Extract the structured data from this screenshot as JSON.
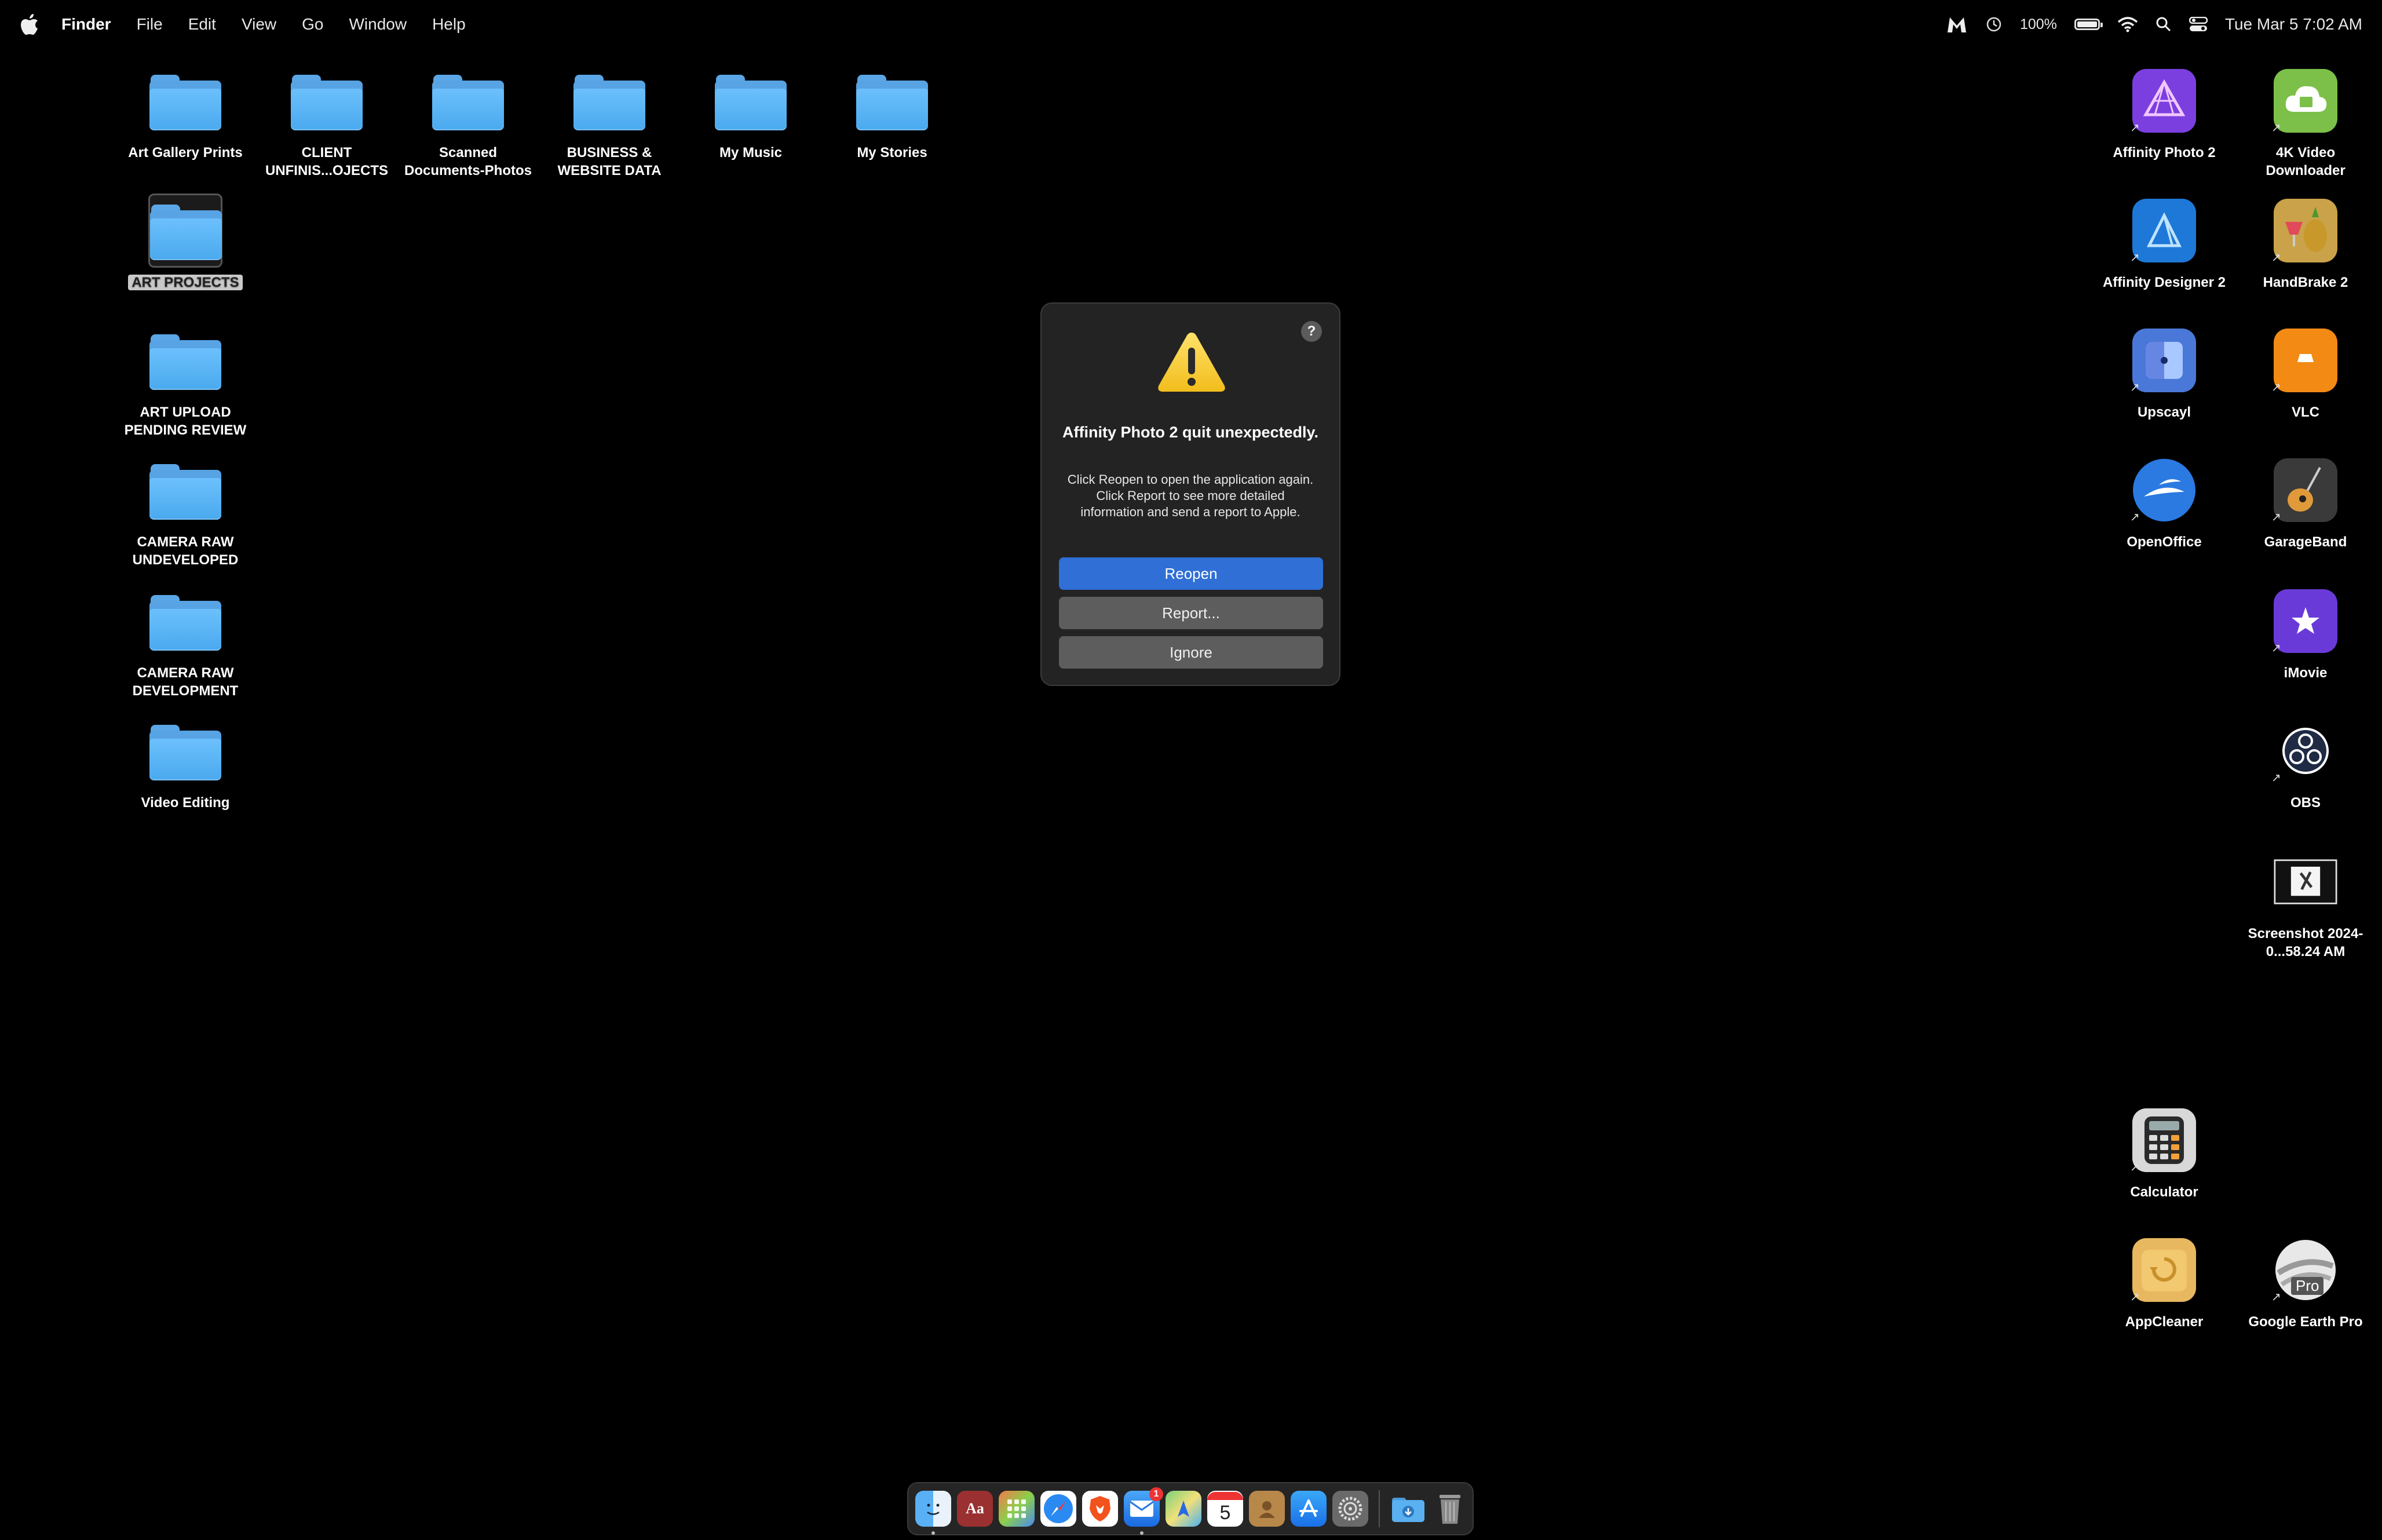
{
  "menubar": {
    "app_name": "Finder",
    "menus": [
      "File",
      "Edit",
      "View",
      "Go",
      "Window",
      "Help"
    ],
    "battery_text": "100%",
    "battery_level": 1.0,
    "clock": "Tue Mar 5  7:02 AM"
  },
  "desktop_folders": [
    {
      "label": "Art Gallery Prints"
    },
    {
      "label": "CLIENT UNFINIS...OJECTS"
    },
    {
      "label": "Scanned Documents-Photos"
    },
    {
      "label": "BUSINESS & WEBSITE DATA"
    },
    {
      "label": "My Music"
    },
    {
      "label": "My Stories"
    },
    {
      "label": "ART PROJECTS"
    },
    {
      "label": "ART UPLOAD PENDING REVIEW"
    },
    {
      "label": "CAMERA RAW UNDEVELOPED"
    },
    {
      "label": "CAMERA RAW DEVELOPMENT"
    },
    {
      "label": "Video Editing"
    }
  ],
  "desktop_apps": [
    {
      "label": "Affinity Photo 2",
      "color": "#7b3fe0"
    },
    {
      "label": "4K Video Downloader",
      "color": "#7cc04a"
    },
    {
      "label": "Affinity Designer 2",
      "color": "#1e78d8"
    },
    {
      "label": "HandBrake 2",
      "color": "#c9a24a"
    },
    {
      "label": "Upscayl",
      "color": "#4a78d8"
    },
    {
      "label": "VLC",
      "color": "#f28a14"
    },
    {
      "label": "OpenOffice",
      "color": "#2a7ae2"
    },
    {
      "label": "GarageBand",
      "color": "#3a3a3a"
    },
    {
      "label": "iMovie",
      "color": "#6a3ad8"
    },
    {
      "label": "OBS",
      "color": "#1f2a44"
    },
    {
      "label": "Screenshot 2024-0...58.24 AM",
      "color": "#222222"
    },
    {
      "label": "Calculator",
      "color": "#d8d8d8"
    },
    {
      "label": "AppCleaner",
      "color": "#e8b860"
    },
    {
      "label": "Google Earth Pro",
      "color": "#cfcfcf"
    }
  ],
  "google_earth_badge": "Pro",
  "dialog": {
    "help_label": "?",
    "title": "Affinity Photo 2 quit unexpectedly.",
    "message": "Click Reopen to open the application again. Click Report to see more detailed information and send a report to Apple.",
    "buttons": {
      "reopen": "Reopen",
      "report": "Report...",
      "ignore": "Ignore"
    }
  },
  "dock": {
    "mail_badge": "1",
    "calendar_day": "5",
    "dictionary_glyph": "Aa",
    "items": [
      "finder",
      "dictionary",
      "launchpad",
      "safari",
      "brave",
      "mail",
      "maps",
      "calendar",
      "contacts",
      "app-store",
      "system-settings",
      "downloads",
      "trash"
    ]
  }
}
